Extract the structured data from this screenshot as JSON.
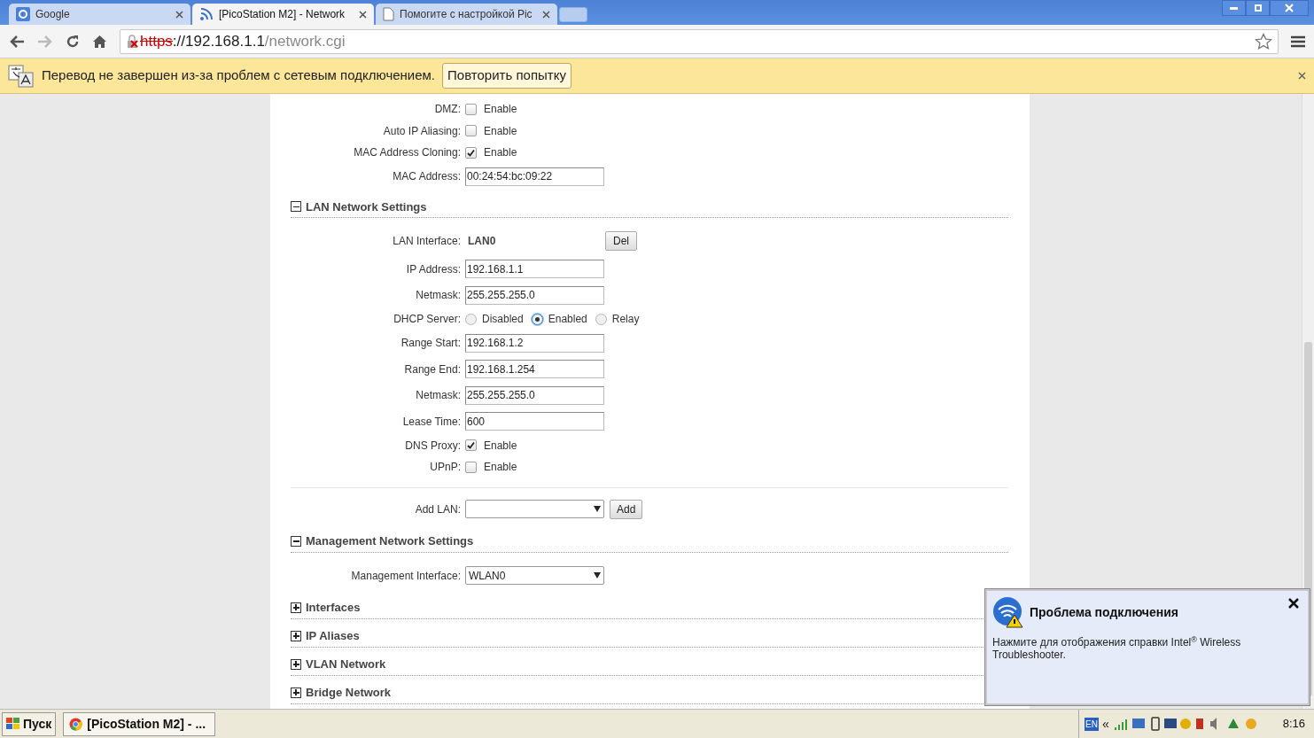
{
  "tabs": [
    {
      "title": "Google",
      "selected": false,
      "kind": "g"
    },
    {
      "title": "[PicoStation M2] - Network",
      "selected": true,
      "kind": "rss"
    },
    {
      "title": "Помогите с настройкой Pic",
      "selected": false,
      "kind": "page"
    }
  ],
  "address": {
    "scheme": "https",
    "host": "://192.168.1.1",
    "path": "/network.cgi"
  },
  "infobar": {
    "message": "Перевод не завершен из-за проблем с сетевым подключением.",
    "button": "Повторить попытку"
  },
  "top_rows": [
    {
      "kind": "checkbox",
      "label": "DMZ:",
      "option": "Enable",
      "checked": false
    },
    {
      "kind": "checkbox",
      "label": "Auto IP Aliasing:",
      "option": "Enable",
      "checked": false
    },
    {
      "kind": "checkbox",
      "label": "MAC Address Cloning:",
      "option": "Enable",
      "checked": true
    },
    {
      "kind": "text",
      "label": "MAC Address:",
      "value": "00:24:54:bc:09:22"
    }
  ],
  "sections": [
    {
      "title": "LAN Network Settings",
      "expanded": true,
      "rows": [
        {
          "kind": "static",
          "label": "LAN Interface:",
          "value": "LAN0",
          "button": "Del"
        },
        {
          "kind": "text",
          "label": "IP Address:",
          "value": "192.168.1.1"
        },
        {
          "kind": "text",
          "label": "Netmask:",
          "value": "255.255.255.0"
        },
        {
          "kind": "radio",
          "label": "DHCP Server:",
          "options": [
            {
              "label": "Disabled",
              "selected": false
            },
            {
              "label": "Enabled",
              "selected": true
            },
            {
              "label": "Relay",
              "selected": false
            }
          ]
        },
        {
          "kind": "text",
          "label": "Range Start:",
          "value": "192.168.1.2"
        },
        {
          "kind": "text",
          "label": "Range End:",
          "value": "192.168.1.254"
        },
        {
          "kind": "text",
          "label": "Netmask:",
          "value": "255.255.255.0"
        },
        {
          "kind": "text",
          "label": "Lease Time:",
          "value": "600"
        },
        {
          "kind": "checkbox",
          "label": "DNS Proxy:",
          "option": "Enable",
          "checked": true
        },
        {
          "kind": "checkbox",
          "label": "UPnP:",
          "option": "Enable",
          "checked": false
        }
      ],
      "footer_rows": [
        {
          "kind": "select",
          "label": "Add LAN:",
          "value": "",
          "button": "Add"
        }
      ]
    },
    {
      "title": "Management Network Settings",
      "expanded": true,
      "rows": [
        {
          "kind": "select",
          "label": "Management Interface:",
          "value": "WLAN0"
        }
      ]
    },
    {
      "title": "Interfaces",
      "expanded": false
    },
    {
      "title": "IP Aliases",
      "expanded": false
    },
    {
      "title": "VLAN Network",
      "expanded": false
    },
    {
      "title": "Bridge Network",
      "expanded": false
    }
  ],
  "notification": {
    "title": "Проблема подключения",
    "body": "Нажмите для отображения справки Intel$^{®}$ Wireless Troubleshooter."
  },
  "taskbar": {
    "start": "Пуск",
    "task": "[PicoStation M2] - ...",
    "language": "EN",
    "chevron": "«",
    "clock": "8:16"
  }
}
